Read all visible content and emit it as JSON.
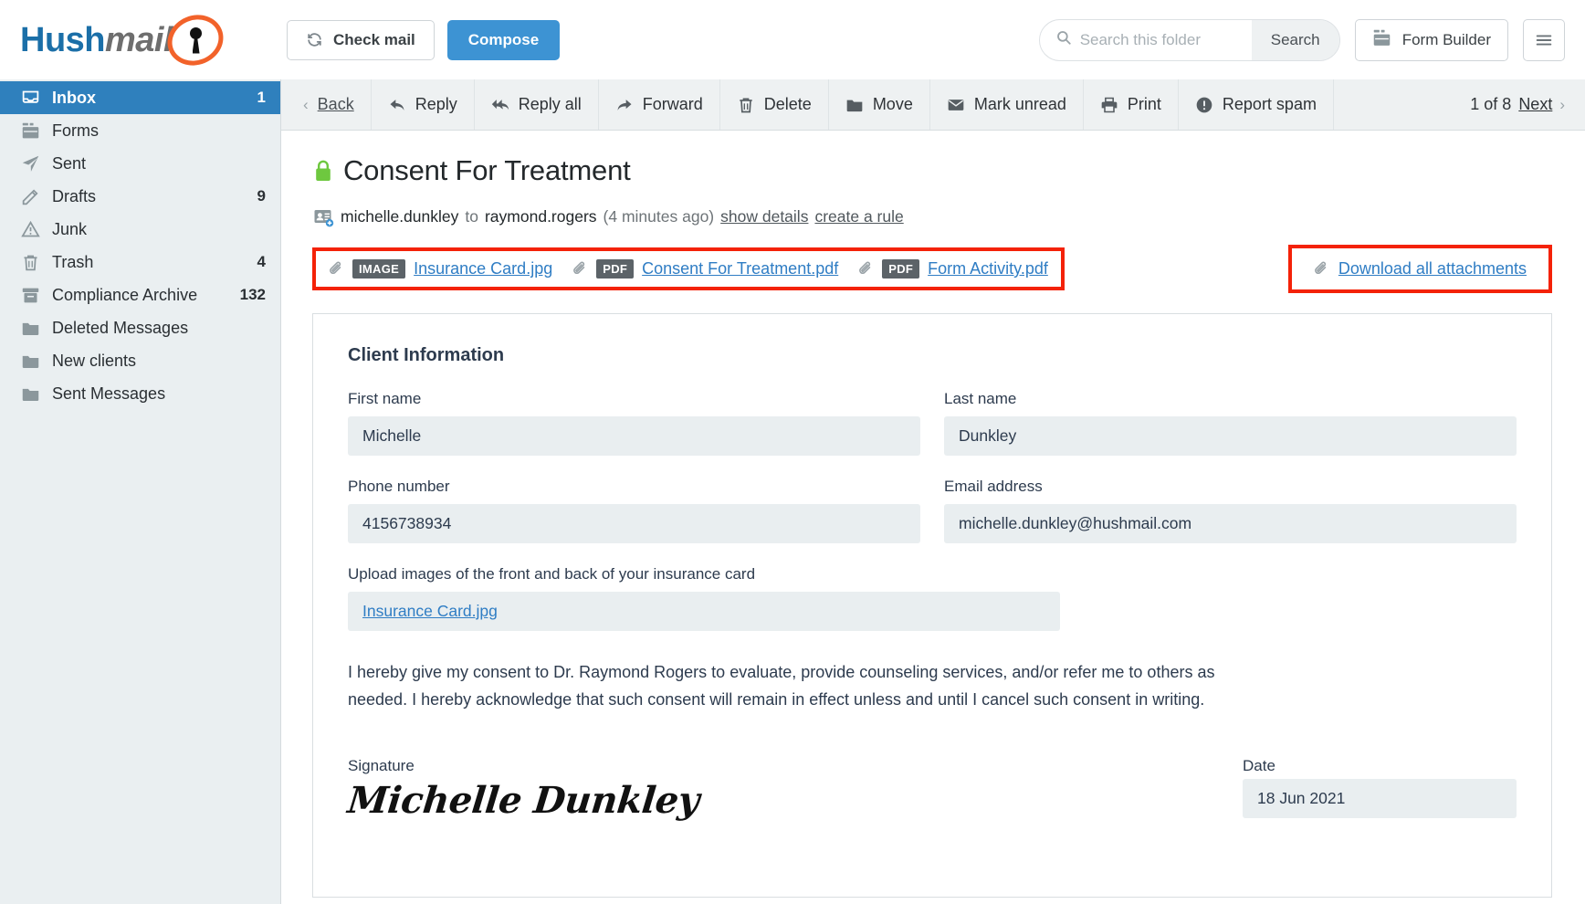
{
  "brand": {
    "name_part1": "Hush",
    "name_part2": "mail",
    "accent_orange": "#f2622a",
    "accent_blue": "#1b6fa8",
    "primary_button_blue": "#3d93d3",
    "highlight_red": "#f42208"
  },
  "topbar": {
    "check_mail_label": "Check mail",
    "compose_label": "Compose",
    "search_placeholder": "Search this folder",
    "search_value": "",
    "search_button_label": "Search",
    "form_builder_label": "Form Builder",
    "menu_icon": "hamburger-icon"
  },
  "sidebar": {
    "items": [
      {
        "label": "Inbox",
        "count": "1",
        "icon": "inbox-tray-icon",
        "active": true
      },
      {
        "label": "Forms",
        "count": "",
        "icon": "forms-icon",
        "active": false
      },
      {
        "label": "Sent",
        "count": "",
        "icon": "paper-plane-icon",
        "active": false
      },
      {
        "label": "Drafts",
        "count": "9",
        "icon": "pencil-icon",
        "active": false
      },
      {
        "label": "Junk",
        "count": "",
        "icon": "warning-triangle-icon",
        "active": false
      },
      {
        "label": "Trash",
        "count": "4",
        "icon": "trash-icon",
        "active": false
      },
      {
        "label": "Compliance Archive",
        "count": "132",
        "icon": "archive-box-icon",
        "active": false
      },
      {
        "label": "Deleted Messages",
        "count": "",
        "icon": "folder-icon",
        "active": false
      },
      {
        "label": "New clients",
        "count": "",
        "icon": "folder-icon",
        "active": false
      },
      {
        "label": "Sent Messages",
        "count": "",
        "icon": "folder-icon",
        "active": false
      }
    ]
  },
  "toolbar": {
    "back_label": "Back",
    "items": [
      {
        "label": "Reply",
        "icon": "reply-arrow-icon"
      },
      {
        "label": "Reply all",
        "icon": "reply-all-arrow-icon"
      },
      {
        "label": "Forward",
        "icon": "forward-arrow-icon"
      },
      {
        "label": "Delete",
        "icon": "trash-icon"
      },
      {
        "label": "Move",
        "icon": "folder-icon"
      },
      {
        "label": "Mark unread",
        "icon": "envelope-icon"
      },
      {
        "label": "Print",
        "icon": "printer-icon"
      },
      {
        "label": "Report spam",
        "icon": "exclamation-circle-icon"
      }
    ],
    "pager_text": "1 of 8",
    "next_label": "Next"
  },
  "message": {
    "subject": "Consent For Treatment",
    "lock_icon": "green-padlock-icon",
    "sender": "michelle.dunkley",
    "to_word": "to",
    "recipient": "raymond.rogers",
    "time": "(4 minutes ago)",
    "show_details_label": "show details",
    "create_rule_label": "create a rule",
    "attachments": [
      {
        "type": "IMAGE",
        "name": "Insurance Card.jpg"
      },
      {
        "type": "PDF",
        "name": "Consent For Treatment.pdf"
      },
      {
        "type": "PDF",
        "name": "Form Activity.pdf"
      }
    ],
    "download_all_label": "Download all attachments"
  },
  "form": {
    "title": "Client Information",
    "fields": [
      {
        "label": "First name",
        "value": "Michelle"
      },
      {
        "label": "Last name",
        "value": "Dunkley"
      },
      {
        "label": "Phone number",
        "value": "4156738934"
      },
      {
        "label": "Email address",
        "value": "michelle.dunkley@hushmail.com"
      }
    ],
    "upload_label": "Upload images of the front and back of your insurance card",
    "upload_file": "Insurance Card.jpg",
    "consent_text": "I hereby give my consent to Dr. Raymond Rogers to evaluate, provide counseling services, and/or refer me to others as needed. I hereby acknowledge that such consent will remain in effect unless and until I cancel such consent in writing.",
    "signature_label": "Signature",
    "signature_value": "Michelle Dunkley",
    "date_label": "Date",
    "date_value": "18 Jun 2021"
  }
}
